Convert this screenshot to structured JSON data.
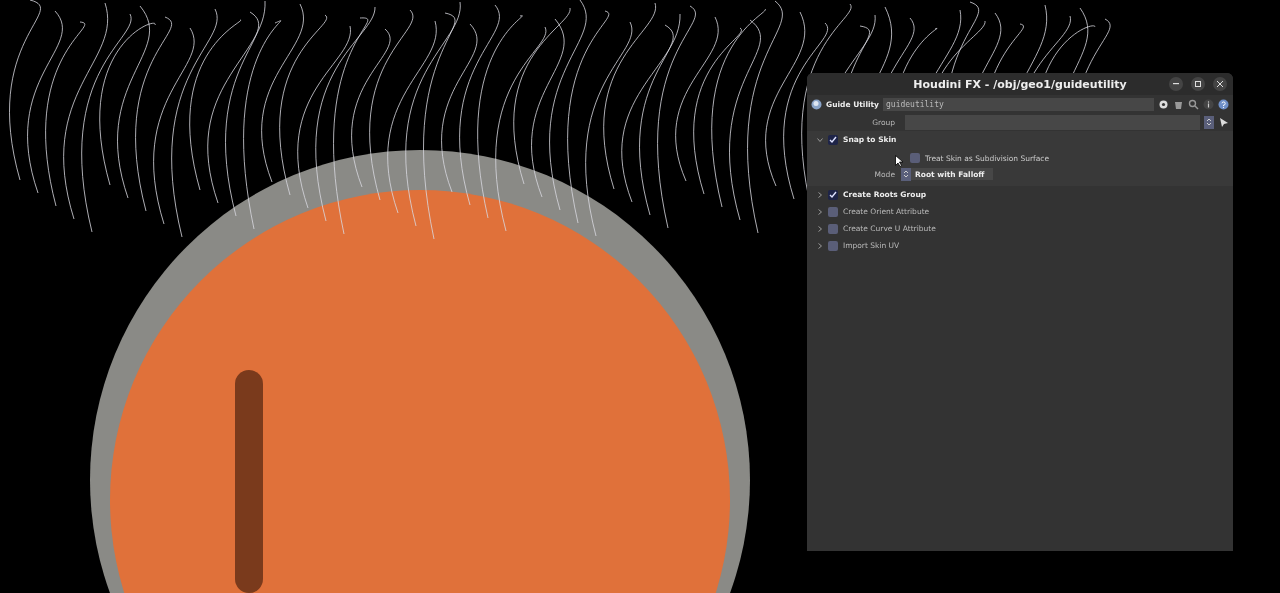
{
  "window": {
    "title": "Houdini FX - /obj/geo1/guideutility"
  },
  "node": {
    "type_label": "Guide Utility",
    "name": "guideutility"
  },
  "group_field": {
    "label": "Group"
  },
  "sections": [
    {
      "label": "Snap to Skin",
      "checked": true,
      "expanded": true,
      "params": [
        {
          "kind": "checkbox",
          "label": "Treat Skin as Subdivision Surface",
          "checked": false
        },
        {
          "kind": "menu",
          "label": "Mode",
          "value": "Root with Falloff"
        }
      ]
    },
    {
      "label": "Create Roots Group",
      "checked": true,
      "expanded": false
    },
    {
      "label": "Create Orient Attribute",
      "checked": false,
      "expanded": false
    },
    {
      "label": "Create Curve U Attribute",
      "checked": false,
      "expanded": false
    },
    {
      "label": "Import Skin UV",
      "checked": false,
      "expanded": false
    }
  ]
}
